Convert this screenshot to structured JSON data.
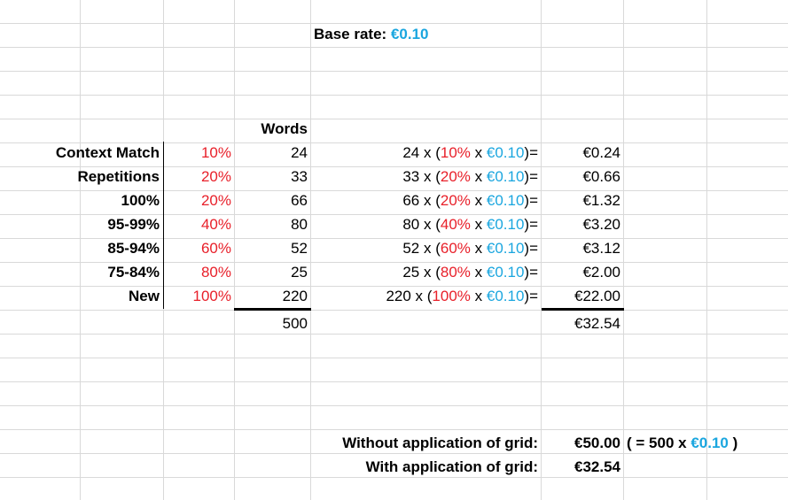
{
  "base_rate": {
    "label": "Base rate:",
    "value": "€0.10"
  },
  "words_header": "Words",
  "rows": [
    {
      "label": "Context Match",
      "pct": "10%",
      "words": "24",
      "f_words": "24",
      "f_pct": "10%",
      "f_rate": "€0.10",
      "cost": "€0.24"
    },
    {
      "label": "Repetitions",
      "pct": "20%",
      "words": "33",
      "f_words": "33",
      "f_pct": "20%",
      "f_rate": "€0.10",
      "cost": "€0.66"
    },
    {
      "label": "100%",
      "pct": "20%",
      "words": "66",
      "f_words": "66",
      "f_pct": "20%",
      "f_rate": "€0.10",
      "cost": "€1.32"
    },
    {
      "label": "95-99%",
      "pct": "40%",
      "words": "80",
      "f_words": "80",
      "f_pct": "40%",
      "f_rate": "€0.10",
      "cost": "€3.20"
    },
    {
      "label": "85-94%",
      "pct": "60%",
      "words": "52",
      "f_words": "52",
      "f_pct": "60%",
      "f_rate": "€0.10",
      "cost": "€3.12"
    },
    {
      "label": "75-84%",
      "pct": "80%",
      "words": "25",
      "f_words": "25",
      "f_pct": "80%",
      "f_rate": "€0.10",
      "cost": "€2.00"
    },
    {
      "label": "New",
      "pct": "100%",
      "words": "220",
      "f_words": "220",
      "f_pct": "100%",
      "f_rate": "€0.10",
      "cost": "€22.00"
    }
  ],
  "totals": {
    "words": "500",
    "cost": "€32.54"
  },
  "summary": {
    "without_label": "Without application of grid:",
    "without_value": "€50.00",
    "without_note_prefix": "( = 500 x ",
    "without_note_rate": "€0.10",
    "without_note_suffix": " )",
    "with_label": "With application of grid:",
    "with_value": "€32.54"
  },
  "colors": {
    "red": "#e8202a",
    "blue": "#1aa6df",
    "grid": "#d9d9d9"
  }
}
